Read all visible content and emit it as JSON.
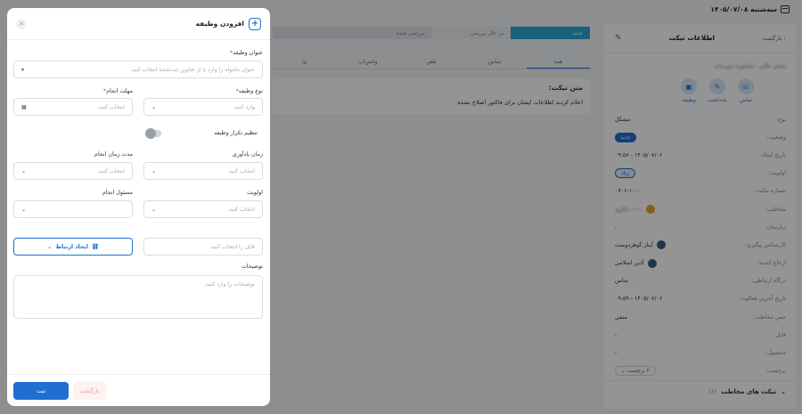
{
  "header": {
    "date": "سه‌شنبه ۱۴۰۵/۰۷/۰۸"
  },
  "steps": [
    "جدید",
    "در حال بررسی",
    "بررسی شده",
    ""
  ],
  "tabs": [
    "همه",
    "تماس",
    "تلفن",
    "واتس‌اپ",
    "پیا"
  ],
  "ticket_text": {
    "heading": "متن تیکت:",
    "body": "اعلام کردند اطلاعات ایشان برای فاکتور اصلاح نشده"
  },
  "ticket_panel": {
    "title": "اطلاعات تیکت",
    "back_label": "بازگشت",
    "name_blurred": "بخش عالی - مشاوره موردیان",
    "actions": [
      {
        "label": "تماس",
        "icon": "phone-icon"
      },
      {
        "label": "یادداشت",
        "icon": "note-icon"
      },
      {
        "label": "وظیفه",
        "icon": "task-icon"
      }
    ],
    "rows": [
      {
        "key": "نوع:",
        "value": "مشکل"
      },
      {
        "key": "وضعیت:",
        "value": "جدید",
        "chip": "blue"
      },
      {
        "key": "تاریخ ایجاد:",
        "value": "۱۴۰۵/۰۷/۰۶ - ۰۹:۵۷"
      },
      {
        "key": "اولویت:",
        "value": "زیاد",
        "chip": "outline"
      },
      {
        "key": "شماره تیکت:",
        "value": "۰۷۰۶-۱۰۰۰"
      },
      {
        "key": "مخاطب:",
        "value": "—— ذاکری",
        "avatar": "orange",
        "blur": true
      },
      {
        "key": "دپارتمان:",
        "value": "-"
      },
      {
        "key": "کارشناس پیگیری:",
        "value": "آیناز گوهردوست",
        "avatar": "blue"
      },
      {
        "key": "ارجاع کننده:",
        "value": "آذین اسلامی",
        "avatar": "blue"
      },
      {
        "key": "درگاه ارتباطی:",
        "value": "تماس"
      },
      {
        "key": "تاریخ آخرین فعالیت:",
        "value": "۱۴۰۵/۰۷/۰۶ - ۰۹:۵۹"
      },
      {
        "key": "حس مخاطب:",
        "value": "منفی"
      },
      {
        "key": "فایل:",
        "value": "-"
      },
      {
        "key": "محصول:",
        "value": "-"
      },
      {
        "key": "برچسب:",
        "value": "۲ برچسب",
        "tag": true
      }
    ],
    "related_label": "تیکت های مخاطب",
    "related_count": "(۸)"
  },
  "modal": {
    "title": "افزودن وظیفه",
    "task_title_label": "عنوان وظیفه",
    "task_title_placeholder": "عنوان دلخواه را وارد یا از عناوین ثبت‌شده انتخاب کنید.",
    "task_type_label": "نوع وظیفه",
    "task_type_placeholder": "وارد کنید.",
    "deadline_label": "مهلت انجام",
    "deadline_placeholder": "انتخاب کنید.",
    "repeat_label": "تنظیم تکرار وظیفه",
    "reminder_label": "زمان یادآوری",
    "reminder_placeholder": "انتخاب کنید.",
    "duration_label": "مدت زمان انجام",
    "duration_placeholder": "انتخاب کنید.",
    "priority_label": "اولویت",
    "priority_placeholder": "انتخاب کنید.",
    "assignee_label": "مسئول انجام",
    "assignee_placeholder": "",
    "link_placeholder": "فایل را انتخاب کنید.",
    "link_button": "ایجاد ارتباط",
    "desc_label": "توضیحات",
    "desc_placeholder": "توضیحات را وارد کنید.",
    "cancel_label": "بازگشت",
    "submit_label": "ثبت"
  }
}
